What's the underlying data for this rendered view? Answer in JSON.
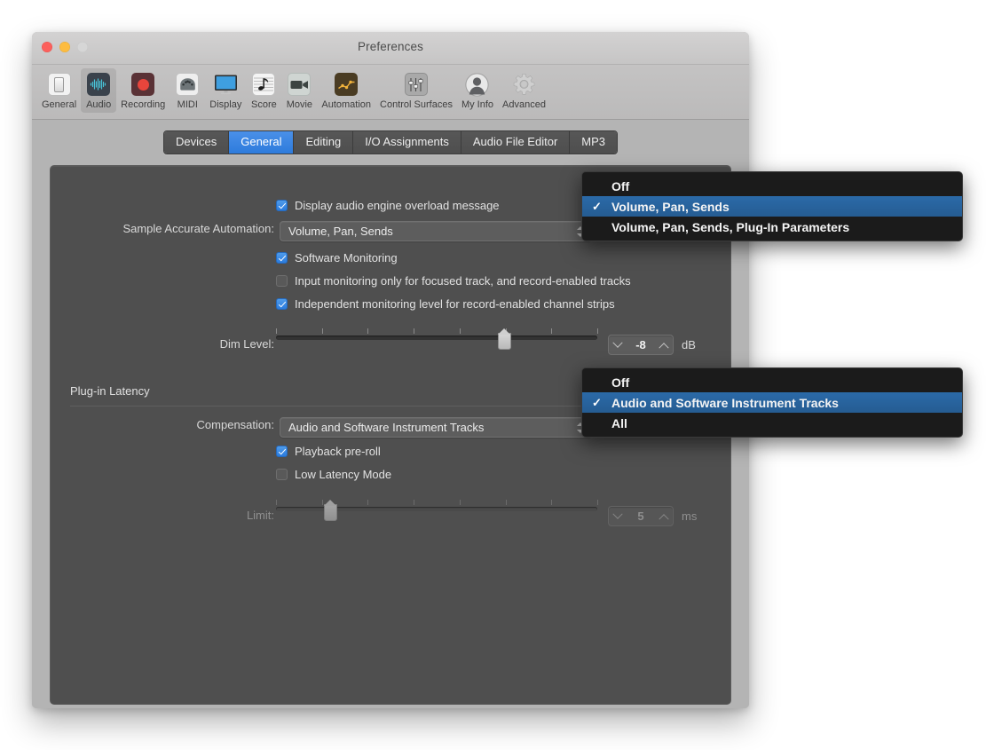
{
  "window": {
    "title": "Preferences",
    "traffic_lights": [
      "close",
      "minimize",
      "zoom"
    ]
  },
  "toolbar": {
    "items": [
      {
        "label": "General",
        "icon": "toggle-switch-icon",
        "selected": false
      },
      {
        "label": "Audio",
        "icon": "waveform-icon",
        "selected": true
      },
      {
        "label": "Recording",
        "icon": "record-dot-icon",
        "selected": false
      },
      {
        "label": "MIDI",
        "icon": "midi-port-icon",
        "selected": false
      },
      {
        "label": "Display",
        "icon": "monitor-icon",
        "selected": false
      },
      {
        "label": "Score",
        "icon": "music-note-icon",
        "selected": false
      },
      {
        "label": "Movie",
        "icon": "video-camera-icon",
        "selected": false
      },
      {
        "label": "Automation",
        "icon": "automation-curve-icon",
        "selected": false
      },
      {
        "label": "Control Surfaces",
        "icon": "faders-icon",
        "selected": false
      },
      {
        "label": "My Info",
        "icon": "person-icon",
        "selected": false
      },
      {
        "label": "Advanced",
        "icon": "gear-icon",
        "selected": false
      }
    ]
  },
  "tabs": [
    {
      "label": "Devices",
      "active": false
    },
    {
      "label": "General",
      "active": true
    },
    {
      "label": "Editing",
      "active": false
    },
    {
      "label": "I/O Assignments",
      "active": false
    },
    {
      "label": "Audio File Editor",
      "active": false
    },
    {
      "label": "MP3",
      "active": false
    }
  ],
  "panel": {
    "overload_checkbox": {
      "label": "Display audio engine overload message",
      "checked": true
    },
    "sample_accurate_automation": {
      "label": "Sample Accurate Automation:",
      "value": "Volume, Pan, Sends"
    },
    "monitoring_checkboxes": [
      {
        "label": "Software Monitoring",
        "checked": true
      },
      {
        "label": "Input monitoring only for focused track, and record-enabled tracks",
        "checked": false
      },
      {
        "label": "Independent monitoring level for record-enabled channel strips",
        "checked": true
      }
    ],
    "dim_level": {
      "label": "Dim Level:",
      "value": "-8",
      "unit": "dB",
      "ticks": 8,
      "thumb_percent": 71,
      "disabled": false
    },
    "plugin_latency": {
      "heading": "Plug-in Latency",
      "compensation": {
        "label": "Compensation:",
        "value": "Audio and Software Instrument Tracks"
      },
      "checkboxes": [
        {
          "label": "Playback pre-roll",
          "checked": true
        },
        {
          "label": "Low Latency Mode",
          "checked": false
        }
      ],
      "limit": {
        "label": "Limit:",
        "value": "5",
        "unit": "ms",
        "ticks": 8,
        "thumb_percent": 17,
        "disabled": true
      }
    }
  },
  "menus": {
    "sample_accurate_automation": {
      "items": [
        {
          "label": "Off",
          "checked": false
        },
        {
          "label": "Volume, Pan, Sends",
          "checked": true
        },
        {
          "label": "Volume, Pan, Sends, Plug-In Parameters",
          "checked": false
        }
      ]
    },
    "compensation": {
      "items": [
        {
          "label": "Off",
          "checked": false
        },
        {
          "label": "Audio and Software Instrument Tracks",
          "checked": true
        },
        {
          "label": "All",
          "checked": false
        }
      ]
    }
  },
  "colors": {
    "accent_blue": "#2d7bdc",
    "menu_selection": "#2b6aa8",
    "panel_bg": "#4f4f4f",
    "window_chrome": "#b4b4b4"
  },
  "icons": {
    "check_glyph": "✓"
  }
}
